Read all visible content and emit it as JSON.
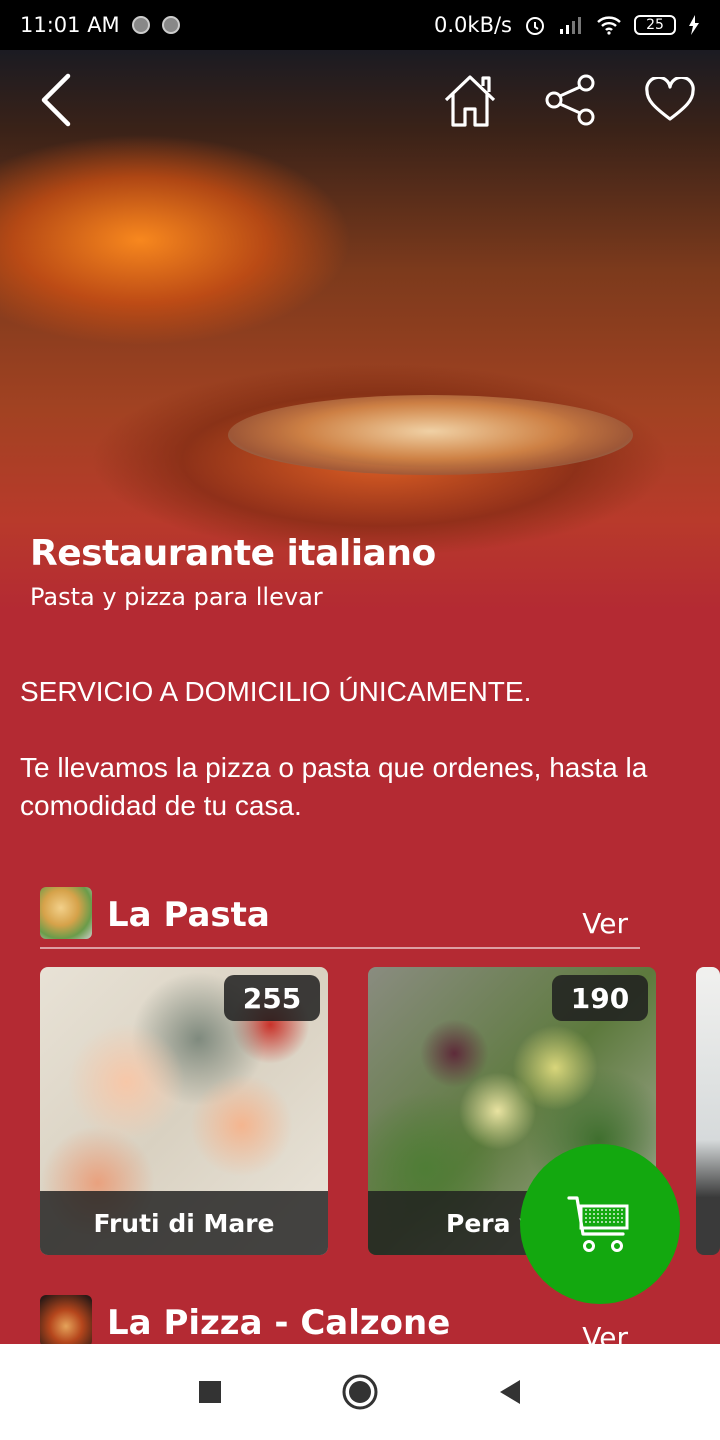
{
  "status_bar": {
    "time": "11:01 AM",
    "network_speed": "0.0kB/s",
    "battery": "25"
  },
  "hero": {
    "title": "Restaurante italiano",
    "subtitle": "Pasta y pizza para llevar"
  },
  "description": {
    "line1": "SERVICIO A DOMICILIO ÚNICAMENTE.",
    "line2": "Te llevamos la pizza o pasta que ordenes, hasta la comodidad de tu casa."
  },
  "sections": [
    {
      "title": "La Pasta",
      "action": "Ver",
      "items": [
        {
          "name": "Fruti di Mare",
          "price": "255"
        },
        {
          "name": "Pera y",
          "price": "190"
        }
      ]
    },
    {
      "title": "La Pizza - Calzone",
      "action": "Ver"
    }
  ],
  "colors": {
    "background": "#b42a33",
    "cart_button": "#13a80f"
  },
  "icons": [
    "back-icon",
    "home-icon",
    "share-icon",
    "heart-icon",
    "cart-icon",
    "nav-square-icon",
    "nav-circle-icon",
    "nav-back-icon"
  ]
}
